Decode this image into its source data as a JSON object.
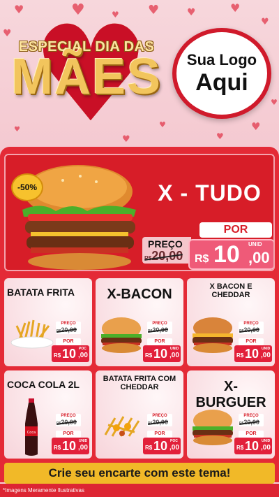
{
  "header": {
    "title_top": "ESPECIAL DIA DAS",
    "title_main": "MÃES",
    "logo_line1": "Sua Logo",
    "logo_line2": "Aqui"
  },
  "featured": {
    "badge": "-50%",
    "name": "X - TUDO",
    "old_label": "PREÇO",
    "old_currency": "R$",
    "old_price": "20,00",
    "por_label": "POR",
    "currency": "R$",
    "price_int": "10",
    "price_dec": ",00",
    "unit": "UNID"
  },
  "products": [
    {
      "name": "BATATA FRITA",
      "old_label": "PREÇO",
      "old_currency": "R$",
      "old_price": "20,00",
      "por_label": "POR",
      "currency": "R$",
      "price_int": "10",
      "price_dec": ",00",
      "unit": "POC",
      "image": "fries"
    },
    {
      "name": "X-BACON",
      "old_label": "PREÇO",
      "old_currency": "R$",
      "old_price": "20,00",
      "por_label": "POR",
      "currency": "R$",
      "price_int": "10",
      "price_dec": ",00",
      "unit": "UNID",
      "image": "burger"
    },
    {
      "name": "X BACON E CHEDDAR",
      "old_label": "PREÇO",
      "old_currency": "R$",
      "old_price": "20,00",
      "por_label": "POR",
      "currency": "R$",
      "price_int": "10",
      "price_dec": ",00",
      "unit": "UNID",
      "image": "burger-cheddar"
    },
    {
      "name": "COCA COLA 2L",
      "old_label": "PREÇO",
      "old_currency": "R$",
      "old_price": "20,00",
      "por_label": "POR",
      "currency": "R$",
      "price_int": "10",
      "price_dec": ",00",
      "unit": "UNID",
      "image": "cola-bottle"
    },
    {
      "name": "BATATA FRITA COM CHEDDAR",
      "old_label": "PREÇO",
      "old_currency": "R$",
      "old_price": "20,00",
      "por_label": "POR",
      "currency": "R$",
      "price_int": "10",
      "price_dec": ",00",
      "unit": "POC",
      "image": "fries-cheddar"
    },
    {
      "name": "X-BURGUER",
      "old_label": "PREÇO",
      "old_currency": "R$",
      "old_price": "20,00",
      "por_label": "POR",
      "currency": "R$",
      "price_int": "10",
      "price_dec": ",00",
      "unit": "UNID",
      "image": "burger"
    }
  ],
  "cta": "Crie seu encarte com este tema!",
  "footer": "*Imagens Meramente Ilustrativas",
  "colors": {
    "red": "#e42a36",
    "pink_bg": "#f3c2cb",
    "gold": "#f2c55d",
    "cta_yellow": "#f1b928"
  }
}
